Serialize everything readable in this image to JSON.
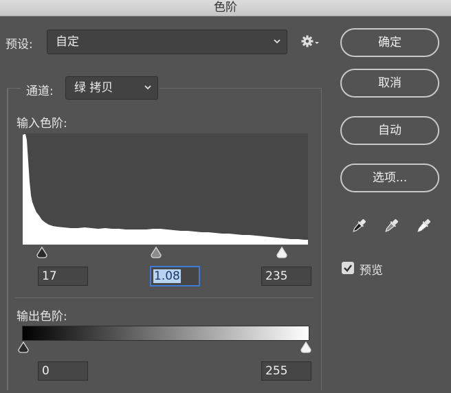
{
  "window": {
    "title": "色阶"
  },
  "preset": {
    "label": "预设:",
    "value": "自定"
  },
  "channel": {
    "label": "通道:",
    "value": "绿 拷贝"
  },
  "input_levels": {
    "label": "输入色阶:",
    "black": "17",
    "gamma": "1.08",
    "white": "235"
  },
  "output_levels": {
    "label": "输出色阶:",
    "black": "0",
    "white": "255"
  },
  "buttons": {
    "ok": "确定",
    "cancel": "取消",
    "auto": "自动",
    "options": "选项..."
  },
  "preview": {
    "label": "预览",
    "checked": true
  },
  "colors": {
    "panel": "#535353",
    "field": "#464646",
    "histogram_bg": "#474747",
    "histogram_fill": "#ffffff",
    "focus": "#3d7bd6"
  },
  "icons": [
    "gear-icon",
    "chevron-down-icon",
    "black-point-eyedropper-icon",
    "gray-point-eyedropper-icon",
    "white-point-eyedropper-icon",
    "checkbox-check-icon"
  ]
}
